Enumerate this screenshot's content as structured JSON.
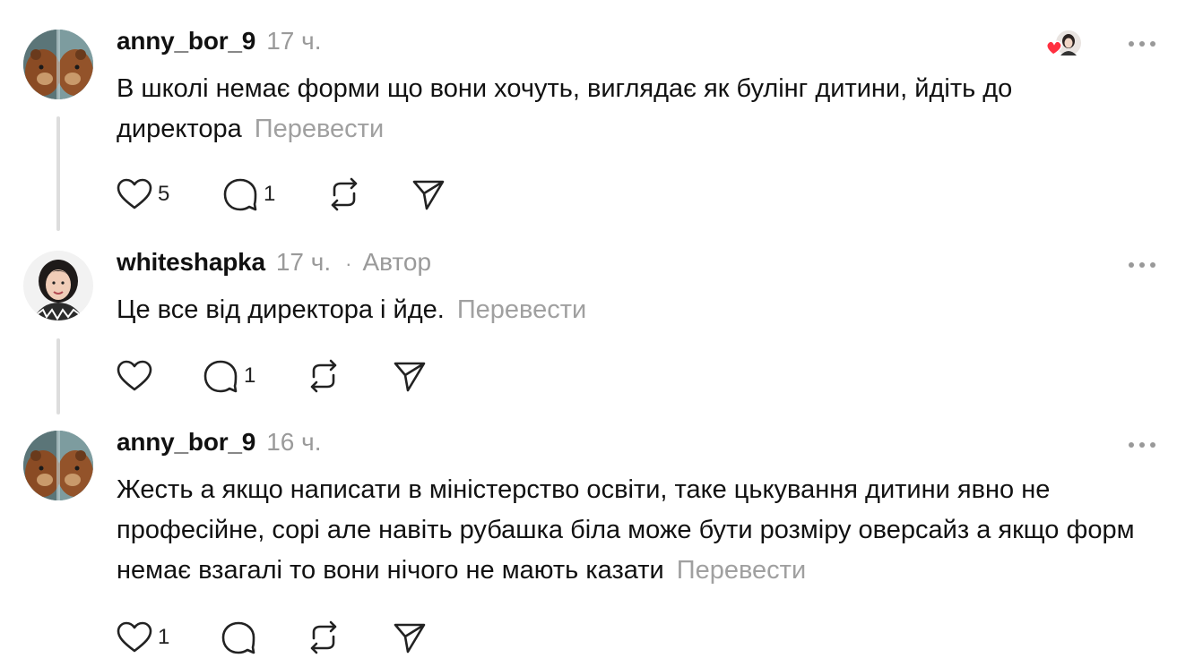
{
  "comments": [
    {
      "username": "anny_bor_9",
      "time": "17 ч.",
      "author_label": "",
      "text": "В школі немає форми що вони хочуть, виглядає як булінг дитини, йдіть до директора",
      "translate": "Перевести",
      "likes": "5",
      "replies": "1",
      "avatar_icon": "bear-avatar",
      "liked_by_author": true
    },
    {
      "username": "whiteshapka",
      "time": "17 ч.",
      "dot": "·",
      "author_label": "Автор",
      "text": "Це все від директора і йде.",
      "translate": "Перевести",
      "likes": "",
      "replies": "1",
      "avatar_icon": "woman-avatar"
    },
    {
      "username": "anny_bor_9",
      "time": "16 ч.",
      "author_label": "",
      "text": "Жесть а якщо написати в міністерство освіти, таке цькування дитини явно не професійне, сорі але навіть рубашка біла може бути розміру оверсайз а якщо форм немає взагалі то вони нічого не мають казати",
      "translate": "Перевести",
      "likes": "1",
      "replies": "",
      "avatar_icon": "bear-avatar"
    }
  ],
  "colors": {
    "heart_red": "#ff3040",
    "muted": "#9a9a9a",
    "thread_line": "#dddddd"
  }
}
